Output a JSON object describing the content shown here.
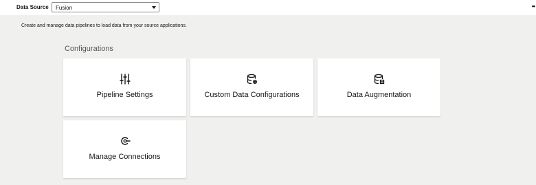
{
  "header": {
    "data_source_label": "Data Source",
    "data_source_value": "Fusion",
    "more_icon": "ellipsis-icon"
  },
  "description": "Create and manage data pipelines to load data from your source applications.",
  "section": {
    "title": "Configurations"
  },
  "cards": [
    {
      "label": "Pipeline Settings",
      "icon": "sliders-icon"
    },
    {
      "label": "Custom Data Configurations",
      "icon": "database-settings-icon"
    },
    {
      "label": "Data Augmentation",
      "icon": "database-augment-icon"
    },
    {
      "label": "Manage Connections",
      "icon": "connection-icon"
    }
  ]
}
